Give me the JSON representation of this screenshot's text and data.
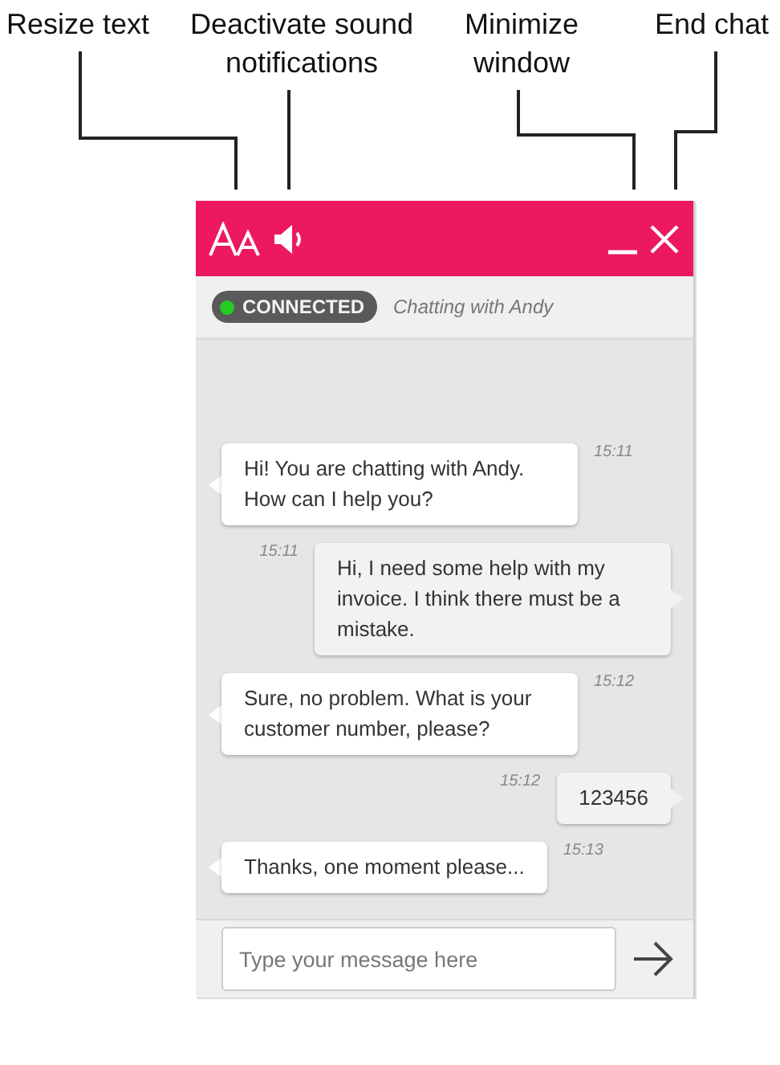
{
  "annotations": [
    {
      "kind": "resize",
      "text": "Resize text"
    },
    {
      "kind": "sound",
      "text": "Deactivate sound notifications"
    },
    {
      "kind": "minimize",
      "text": "Minimize window"
    },
    {
      "kind": "close",
      "text": "End chat"
    }
  ],
  "status": {
    "label": "CONNECTED",
    "connected": true
  },
  "subtitle": "Chatting with Andy",
  "messages": [
    {
      "kind": "agent",
      "text": "Hi! You are chatting with Andy. How can I help you?",
      "time": "15:11"
    },
    {
      "kind": "visitor",
      "text": "Hi, I need some help with my invoice. I think there must be a mistake.",
      "time": "15:11"
    },
    {
      "kind": "agent",
      "text": "Sure, no problem. What is your customer number, please?",
      "time": "15:12"
    },
    {
      "kind": "visitor",
      "text": "123456",
      "time": "15:12"
    },
    {
      "kind": "agent",
      "text": "Thanks, one moment please...",
      "time": "15:13"
    }
  ],
  "composer": {
    "placeholder": "Type your message here"
  }
}
